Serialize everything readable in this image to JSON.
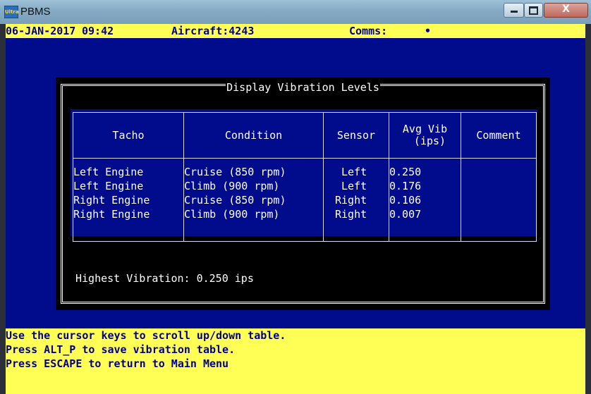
{
  "window": {
    "title": "PBMS",
    "icon_text": "Ultra"
  },
  "status": {
    "date": "06-JAN-2017",
    "time": "09:42",
    "aircraft": "Aircraft:4243",
    "comms_label": "Comms:",
    "comms_indicator": "•"
  },
  "dialog": {
    "title": "Display Vibration Levels",
    "columns": {
      "tacho": "Tacho",
      "condition": "Condition",
      "sensor": "Sensor",
      "avg_vib_line1": "Avg Vib",
      "avg_vib_line2": "(ips)",
      "comment": "Comment"
    },
    "rows": [
      {
        "tacho": "Left Engine",
        "condition": "Cruise (850 rpm)",
        "sensor": "Left",
        "avg_vib": "0.250",
        "comment": ""
      },
      {
        "tacho": "Left Engine",
        "condition": "Climb (900 rpm)",
        "sensor": "Left",
        "avg_vib": "0.176",
        "comment": ""
      },
      {
        "tacho": "Right Engine",
        "condition": "Cruise (850 rpm)",
        "sensor": "Right",
        "avg_vib": "0.106",
        "comment": ""
      },
      {
        "tacho": "Right Engine",
        "condition": "Climb (900 rpm)",
        "sensor": "Right",
        "avg_vib": "0.007",
        "comment": ""
      }
    ],
    "highest": "Highest Vibration: 0.250 ips"
  },
  "help": {
    "line1": "Use the cursor keys to scroll up/down table.",
    "line2": "Press ALT_P to save vibration table.",
    "line3": "Press ESCAPE to return to Main Menu"
  },
  "colors": {
    "screen_bg": "#000c8c",
    "bar_bg": "#ffff55",
    "bar_text": "#00008a",
    "dialog_bg": "#000000"
  }
}
